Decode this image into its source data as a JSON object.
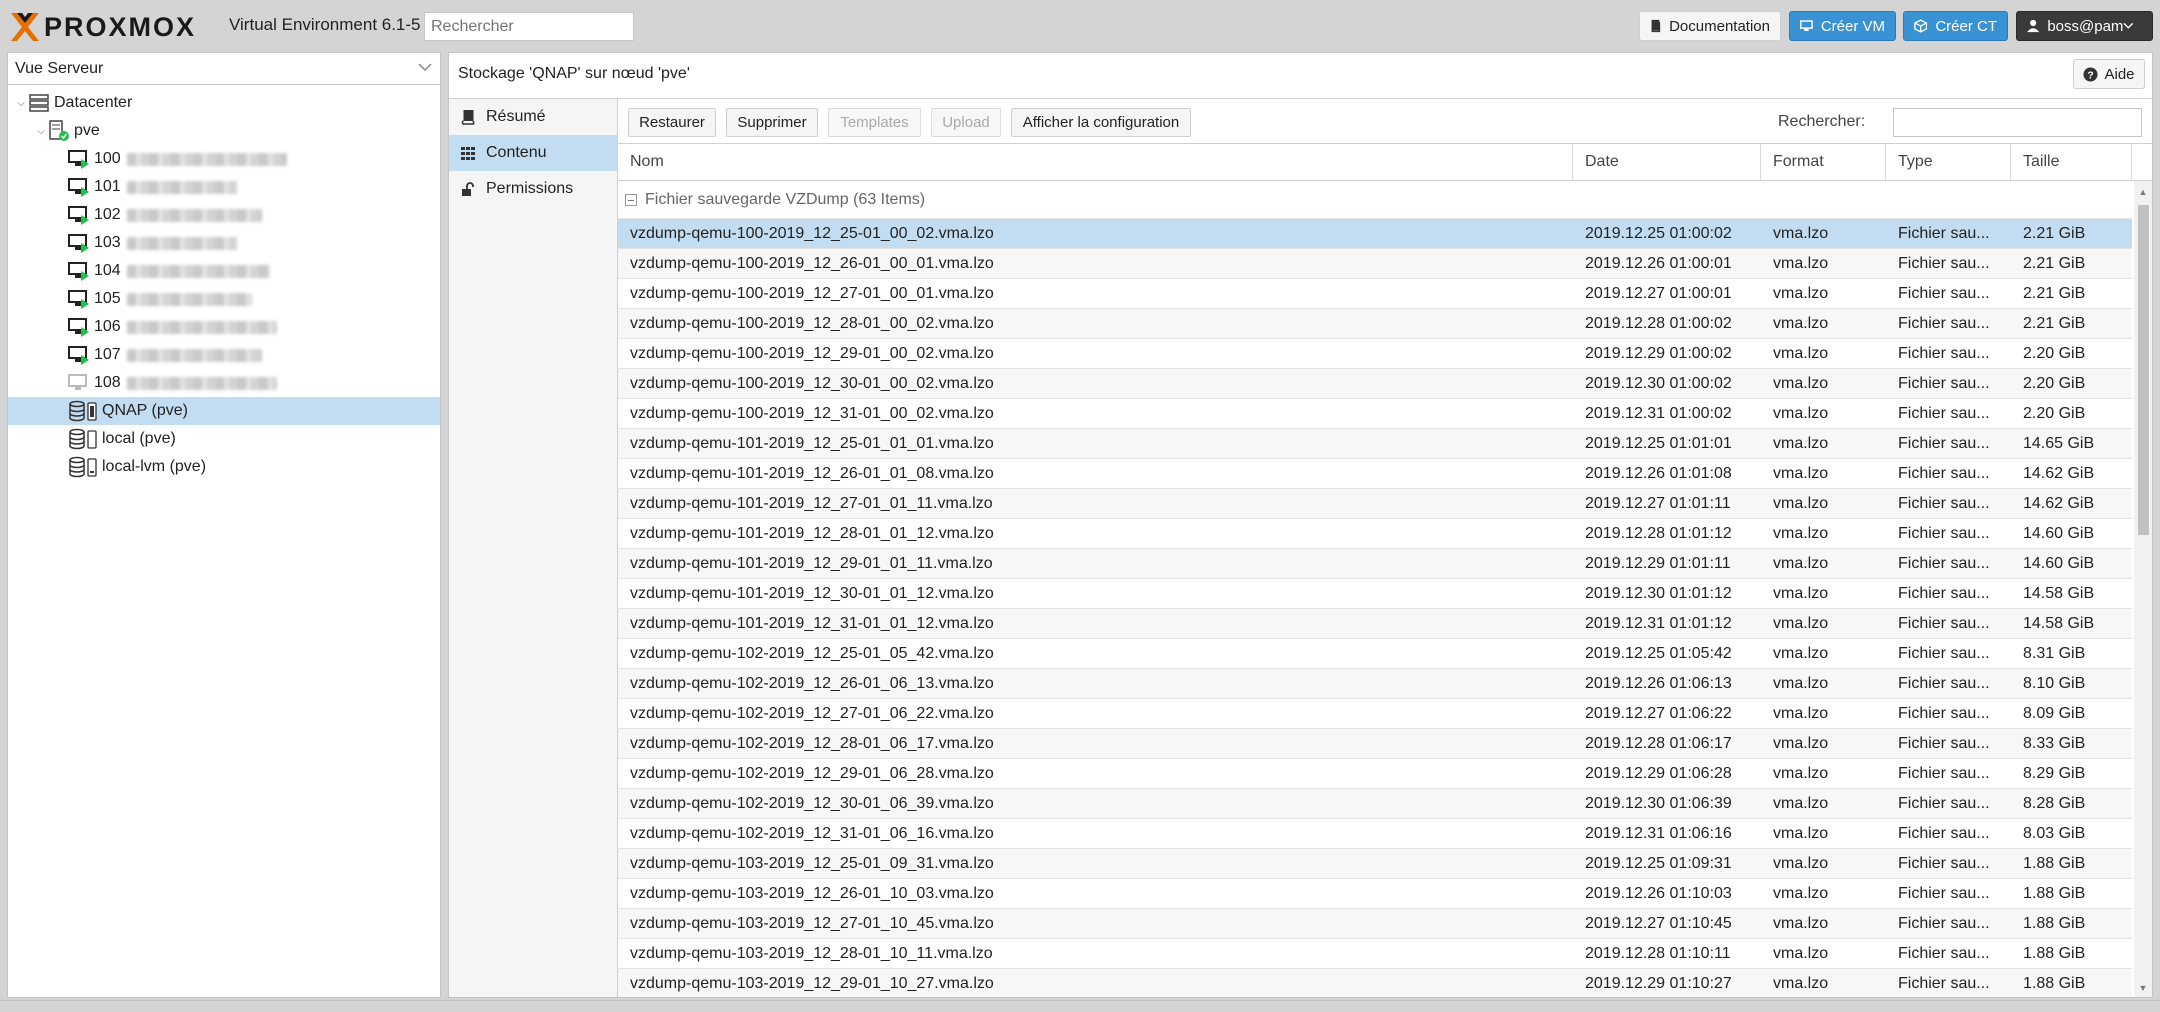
{
  "header": {
    "logo_text": "PROXMOX",
    "product": "Virtual Environment 6.1-5",
    "search_placeholder": "Rechercher",
    "documentation": "Documentation",
    "create_vm": "Créer VM",
    "create_ct": "Créer CT",
    "user": "boss@pam"
  },
  "sidebar": {
    "view": "Vue Serveur",
    "tree": {
      "datacenter": "Datacenter",
      "node": "pve",
      "vms": [
        {
          "id": "100",
          "status": "running"
        },
        {
          "id": "101",
          "status": "running"
        },
        {
          "id": "102",
          "status": "running"
        },
        {
          "id": "103",
          "status": "running"
        },
        {
          "id": "104",
          "status": "running"
        },
        {
          "id": "105",
          "status": "running"
        },
        {
          "id": "106",
          "status": "running"
        },
        {
          "id": "107",
          "status": "running"
        },
        {
          "id": "108",
          "status": "stopped"
        }
      ],
      "storages": [
        "QNAP (pve)",
        "local (pve)",
        "local-lvm (pve)"
      ]
    }
  },
  "main": {
    "title": "Stockage 'QNAP' sur nœud 'pve'",
    "help": "Aide",
    "nav": [
      "Résumé",
      "Contenu",
      "Permissions"
    ],
    "toolbar": {
      "restore": "Restaurer",
      "delete": "Supprimer",
      "templates": "Templates",
      "upload": "Upload",
      "show_config": "Afficher la configuration",
      "search_label": "Rechercher:"
    },
    "columns": [
      "Nom",
      "Date",
      "Format",
      "Type",
      "Taille"
    ],
    "group": "Fichier sauvegarde VZDump (63 Items)",
    "rows": [
      [
        "vzdump-qemu-100-2019_12_25-01_00_02.vma.lzo",
        "2019.12.25 01:00:02",
        "vma.lzo",
        "Fichier sau...",
        "2.21 GiB"
      ],
      [
        "vzdump-qemu-100-2019_12_26-01_00_01.vma.lzo",
        "2019.12.26 01:00:01",
        "vma.lzo",
        "Fichier sau...",
        "2.21 GiB"
      ],
      [
        "vzdump-qemu-100-2019_12_27-01_00_01.vma.lzo",
        "2019.12.27 01:00:01",
        "vma.lzo",
        "Fichier sau...",
        "2.21 GiB"
      ],
      [
        "vzdump-qemu-100-2019_12_28-01_00_02.vma.lzo",
        "2019.12.28 01:00:02",
        "vma.lzo",
        "Fichier sau...",
        "2.21 GiB"
      ],
      [
        "vzdump-qemu-100-2019_12_29-01_00_02.vma.lzo",
        "2019.12.29 01:00:02",
        "vma.lzo",
        "Fichier sau...",
        "2.20 GiB"
      ],
      [
        "vzdump-qemu-100-2019_12_30-01_00_02.vma.lzo",
        "2019.12.30 01:00:02",
        "vma.lzo",
        "Fichier sau...",
        "2.20 GiB"
      ],
      [
        "vzdump-qemu-100-2019_12_31-01_00_02.vma.lzo",
        "2019.12.31 01:00:02",
        "vma.lzo",
        "Fichier sau...",
        "2.20 GiB"
      ],
      [
        "vzdump-qemu-101-2019_12_25-01_01_01.vma.lzo",
        "2019.12.25 01:01:01",
        "vma.lzo",
        "Fichier sau...",
        "14.65 GiB"
      ],
      [
        "vzdump-qemu-101-2019_12_26-01_01_08.vma.lzo",
        "2019.12.26 01:01:08",
        "vma.lzo",
        "Fichier sau...",
        "14.62 GiB"
      ],
      [
        "vzdump-qemu-101-2019_12_27-01_01_11.vma.lzo",
        "2019.12.27 01:01:11",
        "vma.lzo",
        "Fichier sau...",
        "14.62 GiB"
      ],
      [
        "vzdump-qemu-101-2019_12_28-01_01_12.vma.lzo",
        "2019.12.28 01:01:12",
        "vma.lzo",
        "Fichier sau...",
        "14.60 GiB"
      ],
      [
        "vzdump-qemu-101-2019_12_29-01_01_11.vma.lzo",
        "2019.12.29 01:01:11",
        "vma.lzo",
        "Fichier sau...",
        "14.60 GiB"
      ],
      [
        "vzdump-qemu-101-2019_12_30-01_01_12.vma.lzo",
        "2019.12.30 01:01:12",
        "vma.lzo",
        "Fichier sau...",
        "14.58 GiB"
      ],
      [
        "vzdump-qemu-101-2019_12_31-01_01_12.vma.lzo",
        "2019.12.31 01:01:12",
        "vma.lzo",
        "Fichier sau...",
        "14.58 GiB"
      ],
      [
        "vzdump-qemu-102-2019_12_25-01_05_42.vma.lzo",
        "2019.12.25 01:05:42",
        "vma.lzo",
        "Fichier sau...",
        "8.31 GiB"
      ],
      [
        "vzdump-qemu-102-2019_12_26-01_06_13.vma.lzo",
        "2019.12.26 01:06:13",
        "vma.lzo",
        "Fichier sau...",
        "8.10 GiB"
      ],
      [
        "vzdump-qemu-102-2019_12_27-01_06_22.vma.lzo",
        "2019.12.27 01:06:22",
        "vma.lzo",
        "Fichier sau...",
        "8.09 GiB"
      ],
      [
        "vzdump-qemu-102-2019_12_28-01_06_17.vma.lzo",
        "2019.12.28 01:06:17",
        "vma.lzo",
        "Fichier sau...",
        "8.33 GiB"
      ],
      [
        "vzdump-qemu-102-2019_12_29-01_06_28.vma.lzo",
        "2019.12.29 01:06:28",
        "vma.lzo",
        "Fichier sau...",
        "8.29 GiB"
      ],
      [
        "vzdump-qemu-102-2019_12_30-01_06_39.vma.lzo",
        "2019.12.30 01:06:39",
        "vma.lzo",
        "Fichier sau...",
        "8.28 GiB"
      ],
      [
        "vzdump-qemu-102-2019_12_31-01_06_16.vma.lzo",
        "2019.12.31 01:06:16",
        "vma.lzo",
        "Fichier sau...",
        "8.03 GiB"
      ],
      [
        "vzdump-qemu-103-2019_12_25-01_09_31.vma.lzo",
        "2019.12.25 01:09:31",
        "vma.lzo",
        "Fichier sau...",
        "1.88 GiB"
      ],
      [
        "vzdump-qemu-103-2019_12_26-01_10_03.vma.lzo",
        "2019.12.26 01:10:03",
        "vma.lzo",
        "Fichier sau...",
        "1.88 GiB"
      ],
      [
        "vzdump-qemu-103-2019_12_27-01_10_45.vma.lzo",
        "2019.12.27 01:10:45",
        "vma.lzo",
        "Fichier sau...",
        "1.88 GiB"
      ],
      [
        "vzdump-qemu-103-2019_12_28-01_10_11.vma.lzo",
        "2019.12.28 01:10:11",
        "vma.lzo",
        "Fichier sau...",
        "1.88 GiB"
      ],
      [
        "vzdump-qemu-103-2019_12_29-01_10_27.vma.lzo",
        "2019.12.29 01:10:27",
        "vma.lzo",
        "Fichier sau...",
        "1.88 GiB"
      ]
    ]
  },
  "colors": {
    "accent": "#3892d4",
    "selection": "#c2ddf2",
    "logo_orange": "#e57000",
    "running": "#21bf4b"
  }
}
